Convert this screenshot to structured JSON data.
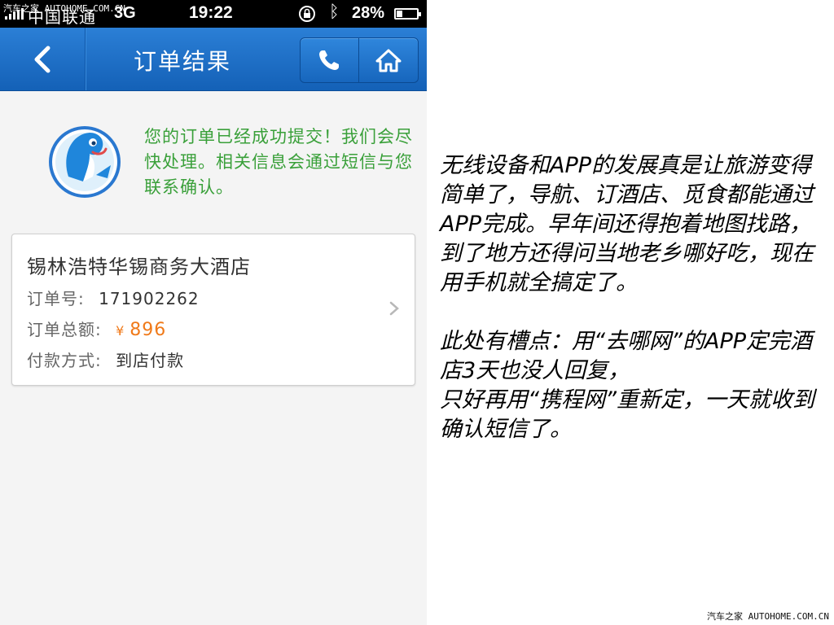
{
  "statusbar": {
    "carrier": "中国联通",
    "network": "3G",
    "time": "19:22",
    "battery_text": "28%",
    "battery_level": 0.28
  },
  "watermark_top": "汽车之家 AUTOHOME.COM.CN",
  "navbar": {
    "title": "订单结果",
    "back_icon": "chevron-left-icon",
    "call_icon": "phone-icon",
    "home_icon": "home-icon"
  },
  "message": {
    "text": "您的订单已经成功提交！我们会尽快处理。相关信息会通过短信与您联系确认。",
    "mascot_icon": "dolphin-mascot"
  },
  "order": {
    "hotel_name": "锡林浩特华锡商务大酒店",
    "order_no_label": "订单号:",
    "order_no_value": "171902262",
    "total_label": "订单总额:",
    "currency": "¥",
    "total_value": "896",
    "payment_label": "付款方式:",
    "payment_value": "到店付款"
  },
  "commentary": {
    "paragraph1": "无线设备和APP的发展真是让旅游变得简单了，导航、订酒店、觅食都能通过APP完成。早年间还得抱着地图找路，到了地方还得问当地老乡哪好吃，现在用手机就全搞定了。",
    "paragraph2_line1": "此处有槽点：用“去哪网”的APP定完酒店3天也没人回复，",
    "paragraph2_line2": "只好再用“携程网”重新定，一天就收到确认短信了。"
  },
  "watermark_bottom": "汽车之家 AUTOHOME.COM.CN",
  "colors": {
    "nav_blue": "#1e6fc8",
    "message_green": "#3aa03a",
    "amount_orange": "#f07a1a",
    "page_bg": "#f4f4f4"
  }
}
